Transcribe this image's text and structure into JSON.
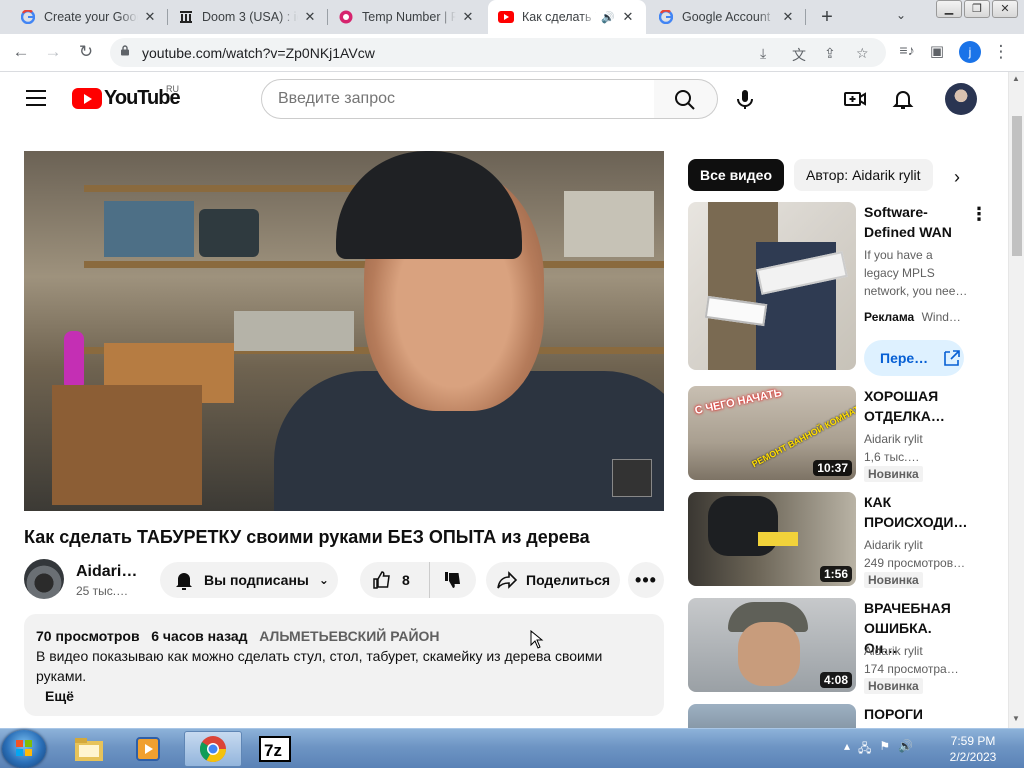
{
  "browser": {
    "tabs": [
      {
        "title": "Create your Goog",
        "icon": "google-icon"
      },
      {
        "title": "Doom 3 (USA) : id",
        "icon": "archive-icon"
      },
      {
        "title": "Temp Number | Fr",
        "icon": "temp-number-icon"
      },
      {
        "title": "Как сделать Т",
        "icon": "youtube-icon",
        "active": true
      },
      {
        "title": "Google Account",
        "icon": "google-icon"
      }
    ],
    "url": "youtube.com/watch?v=Zp0NKj1AVcw",
    "profile_initial": "j"
  },
  "youtube": {
    "logo_text": "YouTube",
    "region": "RU",
    "search_placeholder": "Введите запрос",
    "video": {
      "title": "Как сделать ТАБУРЕТКУ своими руками БЕЗ ОПЫТА из дерева",
      "channel": "Aidari…",
      "subscribers": "25 тыс.…",
      "subscribed_label": "Вы подписаны",
      "likes": "8",
      "share_label": "Поделиться",
      "views": "70 просмотров",
      "age": "6 часов назад",
      "location": "АЛЬМЕТЬЕВСКИЙ РАЙОН",
      "description": "В видео показываю как можно сделать стул, стол, табурет, скамейку из дерева своими руками.",
      "more_label": "Ещё"
    },
    "chips": [
      "Все видео",
      "Автор: Aidarik rylit"
    ],
    "ad": {
      "title": "Software-Defined WAN",
      "text": "If you have a legacy MPLS network, you nee…",
      "label": "Реклама",
      "advertiser": "Wind…",
      "button": "Пере…"
    },
    "recommendations": [
      {
        "title": "ХОРОШАЯ ОТДЕЛКА…",
        "channel": "Aidarik rylit",
        "views": "1,6 тыс.…",
        "badge": "Новинка",
        "duration": "10:37",
        "thumb_text": "С ЧЕГО НАЧАТЬ",
        "thumb_text2": "РЕМОНТ ВАННОЙ КОМНАТЫ"
      },
      {
        "title": "КАК ПРОИСХОДИ…",
        "channel": "Aidarik rylit",
        "views": "249 просмотров…",
        "badge": "Новинка",
        "duration": "1:56"
      },
      {
        "title": "ВРАЧЕБНАЯ ОШИБКА. Он…",
        "channel": "Aidarik rylit",
        "views": "174 просмотра…",
        "badge": "Новинка",
        "duration": "4:08"
      },
      {
        "title": "ПОРОГИ"
      }
    ]
  },
  "taskbar": {
    "time": "7:59 PM",
    "date": "2/2/2023"
  },
  "colors": {
    "youtube_red": "#ff0000",
    "chip_active_bg": "#0f0f0f",
    "ad_button_bg": "#def1ff",
    "ad_button_text": "#065fd4",
    "taskbar": "#6e95c4"
  }
}
